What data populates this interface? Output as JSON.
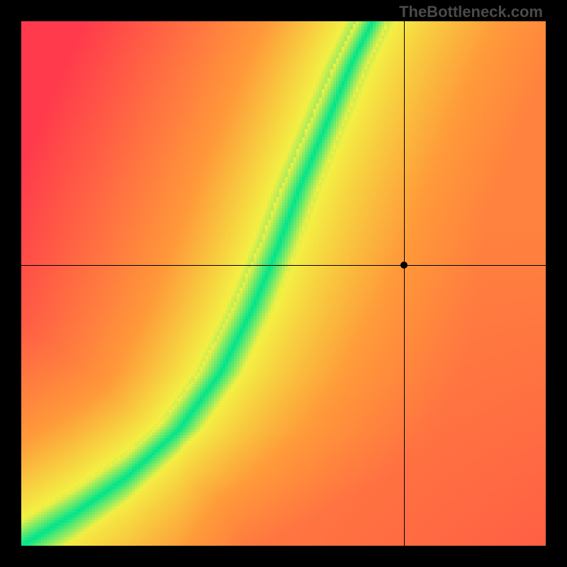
{
  "watermark": "TheBottleneck.com",
  "chart_data": {
    "type": "heatmap",
    "title": "",
    "xlabel": "",
    "ylabel": "",
    "xlim": [
      0,
      1
    ],
    "ylim": [
      0,
      1
    ],
    "grid": false,
    "legend": false,
    "marker": {
      "x": 0.73,
      "y": 0.535
    },
    "crosshair": {
      "x": 0.73,
      "y": 0.535
    },
    "optimal_curve": {
      "description": "green ridge where components are balanced; steep S-like curve through lower-left to upper-center",
      "points": [
        {
          "x": 0.0,
          "y": 0.0
        },
        {
          "x": 0.1,
          "y": 0.06
        },
        {
          "x": 0.2,
          "y": 0.13
        },
        {
          "x": 0.3,
          "y": 0.22
        },
        {
          "x": 0.38,
          "y": 0.33
        },
        {
          "x": 0.44,
          "y": 0.45
        },
        {
          "x": 0.49,
          "y": 0.57
        },
        {
          "x": 0.53,
          "y": 0.68
        },
        {
          "x": 0.58,
          "y": 0.8
        },
        {
          "x": 0.63,
          "y": 0.92
        },
        {
          "x": 0.67,
          "y": 1.0
        }
      ]
    },
    "color_scale": {
      "optimal": "#00E58C",
      "near": "#F4F044",
      "mid": "#FF9A3A",
      "far": "#FF3A4C"
    },
    "interpretation": "Distance from the green curve indicates bottleneck severity. The black marker at (0.73, 0.535) lies to the right of the ridge in the orange zone, indicating a moderate-to-high mismatch."
  }
}
